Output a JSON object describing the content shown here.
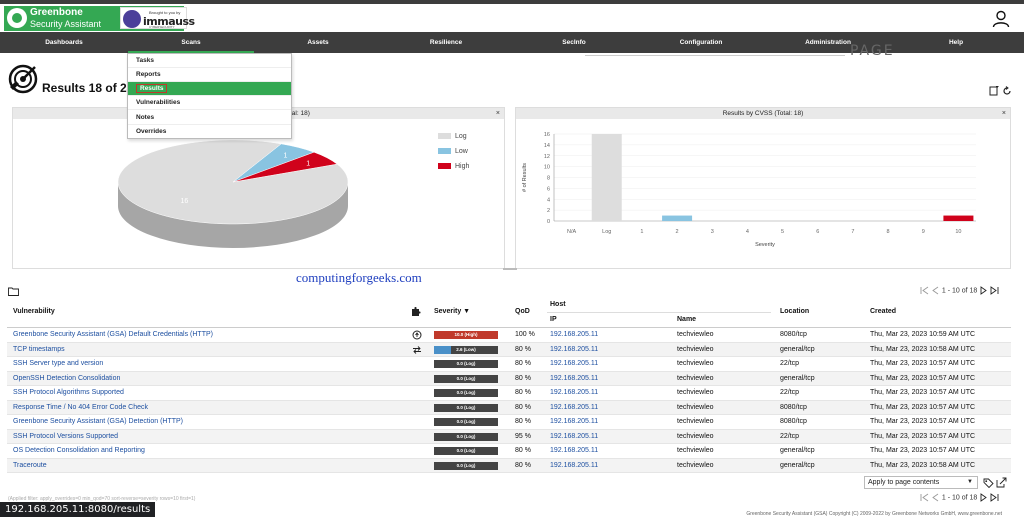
{
  "header": {
    "logo_title": "Greenbone",
    "logo_subtitle": "Security Assistant",
    "brand_small": "Brought to you by",
    "brand_main": "immauss",
    "brand_tag": "CYBERSECURITY",
    "user_icon": "user-icon"
  },
  "nav": {
    "items": [
      "Dashboards",
      "Scans",
      "Assets",
      "Resilience",
      "SecInfo",
      "Configuration",
      "Administration",
      "Help"
    ]
  },
  "scans_menu": {
    "items": [
      "Tasks",
      "Reports",
      "Results",
      "Vulnerabilities",
      "Notes",
      "Overrides"
    ],
    "active": "Results"
  },
  "page": {
    "title": "Results 18 of 24",
    "powerfilter_label": "PAGE"
  },
  "panels": {
    "severity_class": {
      "title_visible": "tal: 18)",
      "close": "×"
    },
    "cvss": {
      "title": "Results by CVSS (Total: 18)",
      "close": "×"
    }
  },
  "chart_data": [
    {
      "type": "pie",
      "title": "",
      "labels": [
        "Log",
        "Low",
        "High"
      ],
      "values": [
        16,
        1,
        1
      ],
      "colors": [
        "#dddddd",
        "#89c4e1",
        "#d0021b"
      ],
      "slice_labels": [
        "16",
        "1",
        "1"
      ],
      "legend_position": "right"
    },
    {
      "type": "bar",
      "title": "Results by CVSS (Total: 18)",
      "categories": [
        "N/A",
        "Log",
        "1",
        "2",
        "3",
        "4",
        "5",
        "6",
        "7",
        "8",
        "9",
        "10"
      ],
      "values": [
        0,
        16,
        0,
        1,
        0,
        0,
        0,
        0,
        0,
        0,
        0,
        1
      ],
      "colors": [
        "#dddddd",
        "#dddddd",
        "#89c4e1",
        "#89c4e1",
        "#89c4e1",
        "#f0a519",
        "#f0a519",
        "#f0a519",
        "#d0021b",
        "#d0021b",
        "#d0021b",
        "#d0021b"
      ],
      "xlabel": "Severity",
      "ylabel": "# of Results",
      "yticks": [
        0,
        2,
        4,
        6,
        8,
        10,
        12,
        14,
        16
      ],
      "ylim": [
        0,
        16
      ],
      "grid": true
    }
  ],
  "watermark": "computingforgeeks.com",
  "table": {
    "pager_text": "1 - 10 of 18",
    "headers": {
      "vulnerability": "Vulnerability",
      "severity": "Severity ▼",
      "qod": "QoD",
      "host": "Host",
      "ip": "IP",
      "name": "Name",
      "location": "Location",
      "created": "Created"
    },
    "rows": [
      {
        "vuln": "Greenbone Security Assistant (GSA) Default Credentials (HTTP)",
        "icon": "solution-vendorfix-icon",
        "severity_text": "10.0 (High)",
        "severity_value": 10.0,
        "severity_color": "#c0392b",
        "qod": "100 %",
        "ip": "192.168.205.11",
        "name": "techviewleo",
        "location": "8080/tcp",
        "created": "Thu, Mar 23, 2023 10:59 AM UTC"
      },
      {
        "vuln": "TCP timestamps",
        "icon": "solution-mitigation-icon",
        "severity_text": "2.6 (Low)",
        "severity_value": 2.6,
        "severity_color": "#4a90c8",
        "qod": "80 %",
        "ip": "192.168.205.11",
        "name": "techviewleo",
        "location": "general/tcp",
        "created": "Thu, Mar 23, 2023 10:58 AM UTC"
      },
      {
        "vuln": "SSH Server type and version",
        "icon": "",
        "severity_text": "0.0 (Log)",
        "severity_value": 0.0,
        "severity_color": "#444444",
        "qod": "80 %",
        "ip": "192.168.205.11",
        "name": "techviewleo",
        "location": "22/tcp",
        "created": "Thu, Mar 23, 2023 10:57 AM UTC"
      },
      {
        "vuln": "OpenSSH Detection Consolidation",
        "icon": "",
        "severity_text": "0.0 (Log)",
        "severity_value": 0.0,
        "severity_color": "#444444",
        "qod": "80 %",
        "ip": "192.168.205.11",
        "name": "techviewleo",
        "location": "general/tcp",
        "created": "Thu, Mar 23, 2023 10:57 AM UTC"
      },
      {
        "vuln": "SSH Protocol Algorithms Supported",
        "icon": "",
        "severity_text": "0.0 (Log)",
        "severity_value": 0.0,
        "severity_color": "#444444",
        "qod": "80 %",
        "ip": "192.168.205.11",
        "name": "techviewleo",
        "location": "22/tcp",
        "created": "Thu, Mar 23, 2023 10:57 AM UTC"
      },
      {
        "vuln": "Response Time / No 404 Error Code Check",
        "icon": "",
        "severity_text": "0.0 (Log)",
        "severity_value": 0.0,
        "severity_color": "#444444",
        "qod": "80 %",
        "ip": "192.168.205.11",
        "name": "techviewleo",
        "location": "8080/tcp",
        "created": "Thu, Mar 23, 2023 10:57 AM UTC"
      },
      {
        "vuln": "Greenbone Security Assistant (GSA) Detection (HTTP)",
        "icon": "",
        "severity_text": "0.0 (Log)",
        "severity_value": 0.0,
        "severity_color": "#444444",
        "qod": "80 %",
        "ip": "192.168.205.11",
        "name": "techviewleo",
        "location": "8080/tcp",
        "created": "Thu, Mar 23, 2023 10:57 AM UTC"
      },
      {
        "vuln": "SSH Protocol Versions Supported",
        "icon": "",
        "severity_text": "0.0 (Log)",
        "severity_value": 0.0,
        "severity_color": "#444444",
        "qod": "95 %",
        "ip": "192.168.205.11",
        "name": "techviewleo",
        "location": "22/tcp",
        "created": "Thu, Mar 23, 2023 10:57 AM UTC"
      },
      {
        "vuln": "OS Detection Consolidation and Reporting",
        "icon": "",
        "severity_text": "0.0 (Log)",
        "severity_value": 0.0,
        "severity_color": "#444444",
        "qod": "80 %",
        "ip": "192.168.205.11",
        "name": "techviewleo",
        "location": "general/tcp",
        "created": "Thu, Mar 23, 2023 10:57 AM UTC"
      },
      {
        "vuln": "Traceroute",
        "icon": "",
        "severity_text": "0.0 (Log)",
        "severity_value": 0.0,
        "severity_color": "#444444",
        "qod": "80 %",
        "ip": "192.168.205.11",
        "name": "techviewleo",
        "location": "general/tcp",
        "created": "Thu, Mar 23, 2023 10:58 AM UTC"
      }
    ],
    "apply_select": "Apply to page contents",
    "applied_filter": "(Applied filter: apply_overrides=0 min_qod=70 sort-reverse=severity rows=10 first=1)"
  },
  "footer": {
    "copyright": "Greenbone Security Assistant (GSA) Copyright (C) 2009-2022 by Greenbone Networks GmbH, www.greenbone.net"
  },
  "status_bar": {
    "url": "192.168.205.11:8080/results"
  }
}
